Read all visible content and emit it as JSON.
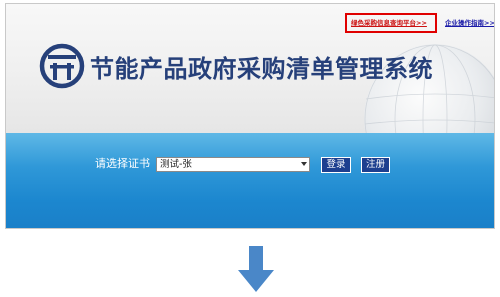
{
  "header": {
    "title": "节能产品政府采购清单管理系统",
    "logo_icon": "ntc-logo-icon",
    "links": {
      "green_platform": "绿色采购信息查询平台>>",
      "enterprise_guide": "企业操作指南>>"
    }
  },
  "login": {
    "select_label": "请选择证书",
    "selected_certificate": "测试-张",
    "login_button": "登录",
    "register_button": "注册"
  },
  "colors": {
    "title_blue": "#26407a",
    "band_blue": "#1c87cf",
    "button_navy": "#1d3f8f",
    "highlight_red": "#e00000",
    "arrow_blue": "#4a87c8"
  },
  "indicator": {
    "icon": "down-arrow-icon"
  }
}
